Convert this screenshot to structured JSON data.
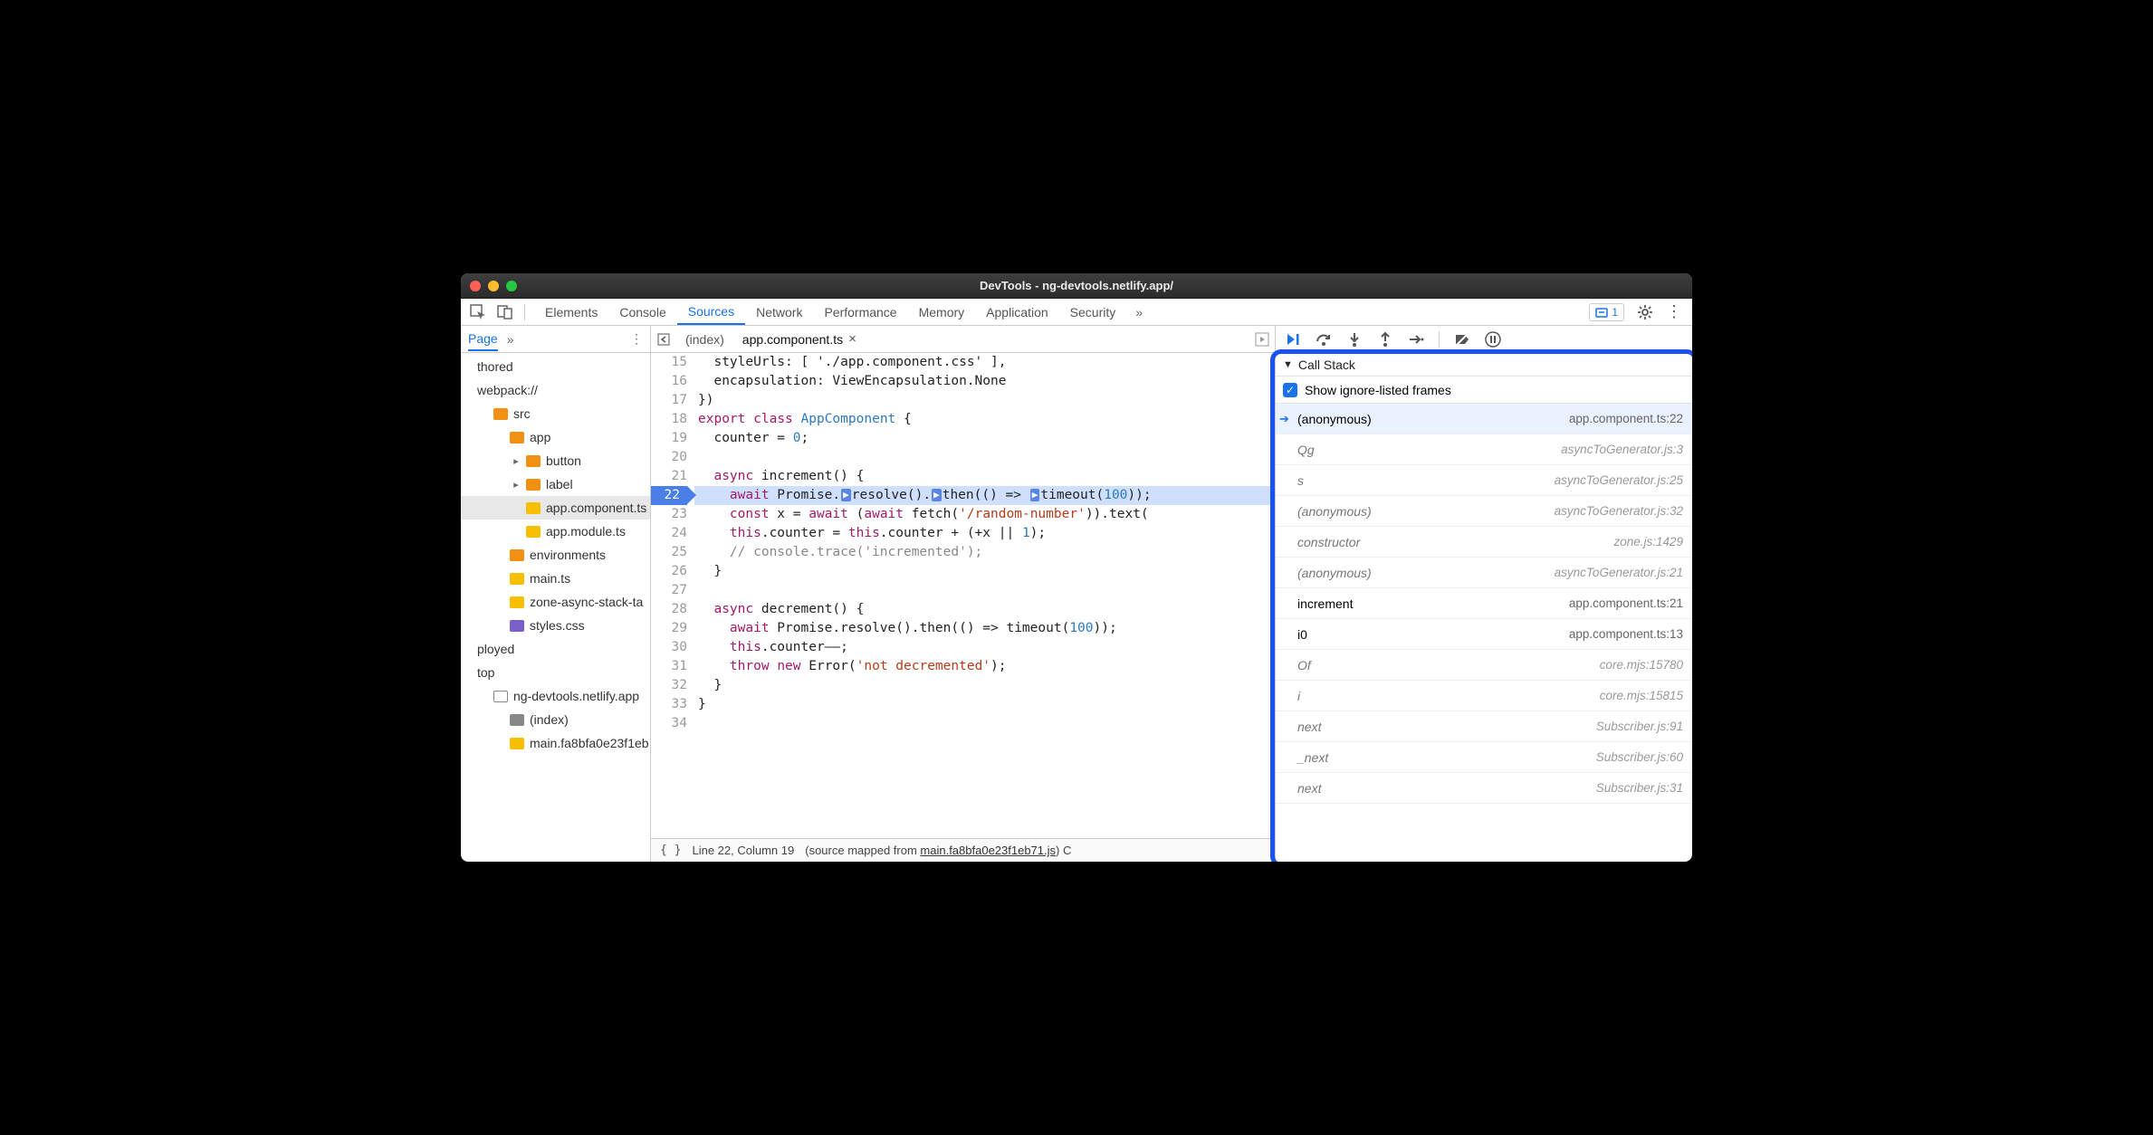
{
  "window": {
    "title": "DevTools - ng-devtools.netlify.app/"
  },
  "mainTabs": {
    "items": [
      "Elements",
      "Console",
      "Sources",
      "Network",
      "Performance",
      "Memory",
      "Application",
      "Security"
    ],
    "active": "Sources",
    "issueCount": "1"
  },
  "navigator": {
    "tab": "Page",
    "tree": [
      {
        "label": "thored",
        "indent": 0,
        "icon": "",
        "disc": ""
      },
      {
        "label": "webpack://",
        "indent": 0,
        "icon": "",
        "disc": ""
      },
      {
        "label": "src",
        "indent": 1,
        "icon": "f-orange",
        "disc": ""
      },
      {
        "label": "app",
        "indent": 2,
        "icon": "f-orange",
        "disc": ""
      },
      {
        "label": "button",
        "indent": 3,
        "icon": "f-orange",
        "disc": "▸"
      },
      {
        "label": "label",
        "indent": 3,
        "icon": "f-orange",
        "disc": "▸"
      },
      {
        "label": "app.component.ts",
        "indent": 3,
        "icon": "f-yellow",
        "disc": "",
        "selected": true
      },
      {
        "label": "app.module.ts",
        "indent": 3,
        "icon": "f-yellow",
        "disc": ""
      },
      {
        "label": "environments",
        "indent": 2,
        "icon": "f-orange",
        "disc": ""
      },
      {
        "label": "main.ts",
        "indent": 2,
        "icon": "f-yellow",
        "disc": ""
      },
      {
        "label": "zone-async-stack-ta",
        "indent": 2,
        "icon": "f-yellow",
        "disc": ""
      },
      {
        "label": "styles.css",
        "indent": 2,
        "icon": "f-purple",
        "disc": ""
      },
      {
        "label": "ployed",
        "indent": 0,
        "icon": "",
        "disc": ""
      },
      {
        "label": "top",
        "indent": 0,
        "icon": "",
        "disc": ""
      },
      {
        "label": "ng-devtools.netlify.app",
        "indent": 1,
        "icon": "f-outline",
        "disc": ""
      },
      {
        "label": "(index)",
        "indent": 2,
        "icon": "f-grey",
        "disc": ""
      },
      {
        "label": "main.fa8bfa0e23f1eb",
        "indent": 2,
        "icon": "f-yellow",
        "disc": ""
      }
    ]
  },
  "editor": {
    "tabs": [
      {
        "label": "(index)",
        "active": false,
        "closable": false
      },
      {
        "label": "app.component.ts",
        "active": true,
        "closable": true
      }
    ],
    "gutterStart": 15,
    "breakpointLine": 22,
    "lines": [
      {
        "n": 15,
        "html": "&nbsp;&nbsp;<span class='tok-kw'></span>styleUrls: [ './app.component.css' ],",
        "trunc": true
      },
      {
        "n": 16,
        "html": "&nbsp;&nbsp;encapsulation: ViewEncapsulation.None"
      },
      {
        "n": 17,
        "html": "})"
      },
      {
        "n": 18,
        "html": "<span class='tok-kw'>export</span> <span class='tok-kw'>class</span> <span class='tok-type'>AppComponent</span> {"
      },
      {
        "n": 19,
        "html": "&nbsp;&nbsp;counter = <span class='tok-num'>0</span>;"
      },
      {
        "n": 20,
        "html": ""
      },
      {
        "n": 21,
        "html": "&nbsp;&nbsp;<span class='tok-kw'>async</span> <span>increment</span>() {"
      },
      {
        "n": 22,
        "html": "&nbsp;&nbsp;&nbsp;&nbsp;<span class='tok-kw'>await</span> Promise.<span class='pill'>▶</span>resolve().<span class='pill'>▶</span>then(() =&gt; <span class='pill'>▶</span>timeout(<span class='tok-num'>100</span>));",
        "hl": true
      },
      {
        "n": 23,
        "html": "&nbsp;&nbsp;&nbsp;&nbsp;<span class='tok-kw'>const</span> x = <span class='tok-kw'>await</span> (<span class='tok-kw'>await</span> fetch(<span class='tok-str'>'/random-number'</span>)).text("
      },
      {
        "n": 24,
        "html": "&nbsp;&nbsp;&nbsp;&nbsp;<span class='tok-kw'>this</span>.counter = <span class='tok-kw'>this</span>.counter + (+x || <span class='tok-num'>1</span>);"
      },
      {
        "n": 25,
        "html": "&nbsp;&nbsp;&nbsp;&nbsp;<span class='tok-com'>// console.trace('incremented');</span>"
      },
      {
        "n": 26,
        "html": "&nbsp;&nbsp;}"
      },
      {
        "n": 27,
        "html": ""
      },
      {
        "n": 28,
        "html": "&nbsp;&nbsp;<span class='tok-kw'>async</span> decrement() {"
      },
      {
        "n": 29,
        "html": "&nbsp;&nbsp;&nbsp;&nbsp;<span class='tok-kw'>await</span> Promise.resolve().then(() =&gt; timeout(<span class='tok-num'>100</span>));"
      },
      {
        "n": 30,
        "html": "&nbsp;&nbsp;&nbsp;&nbsp;<span class='tok-kw'>this</span>.counter––;"
      },
      {
        "n": 31,
        "html": "&nbsp;&nbsp;&nbsp;&nbsp;<span class='tok-kw'>throw</span> <span class='tok-kw'>new</span> Error(<span class='tok-str'>'not decremented'</span>);"
      },
      {
        "n": 32,
        "html": "&nbsp;&nbsp;}"
      },
      {
        "n": 33,
        "html": "}"
      },
      {
        "n": 34,
        "html": ""
      }
    ]
  },
  "status": {
    "position": "Line 22, Column 19",
    "mappedPrefix": "(source mapped from ",
    "mappedFile": "main.fa8bfa0e23f1eb71.js",
    "mappedSuffix": ") C"
  },
  "debug": {
    "sectionTitle": "Call Stack",
    "checkboxLabel": "Show ignore-listed frames",
    "frames": [
      {
        "fn": "(anonymous)",
        "loc": "app.component.ts:22",
        "ignored": false,
        "current": true
      },
      {
        "fn": "Qg",
        "loc": "asyncToGenerator.js:3",
        "ignored": true
      },
      {
        "fn": "s",
        "loc": "asyncToGenerator.js:25",
        "ignored": true
      },
      {
        "fn": "(anonymous)",
        "loc": "asyncToGenerator.js:32",
        "ignored": true
      },
      {
        "fn": "constructor",
        "loc": "zone.js:1429",
        "ignored": true
      },
      {
        "fn": "(anonymous)",
        "loc": "asyncToGenerator.js:21",
        "ignored": true
      },
      {
        "fn": "increment",
        "loc": "app.component.ts:21",
        "ignored": false
      },
      {
        "fn": "i0",
        "loc": "app.component.ts:13",
        "ignored": false
      },
      {
        "fn": "Of",
        "loc": "core.mjs:15780",
        "ignored": true
      },
      {
        "fn": "i",
        "loc": "core.mjs:15815",
        "ignored": true
      },
      {
        "fn": "next",
        "loc": "Subscriber.js:91",
        "ignored": true
      },
      {
        "fn": "_next",
        "loc": "Subscriber.js:60",
        "ignored": true
      },
      {
        "fn": "next",
        "loc": "Subscriber.js:31",
        "ignored": true
      }
    ]
  }
}
